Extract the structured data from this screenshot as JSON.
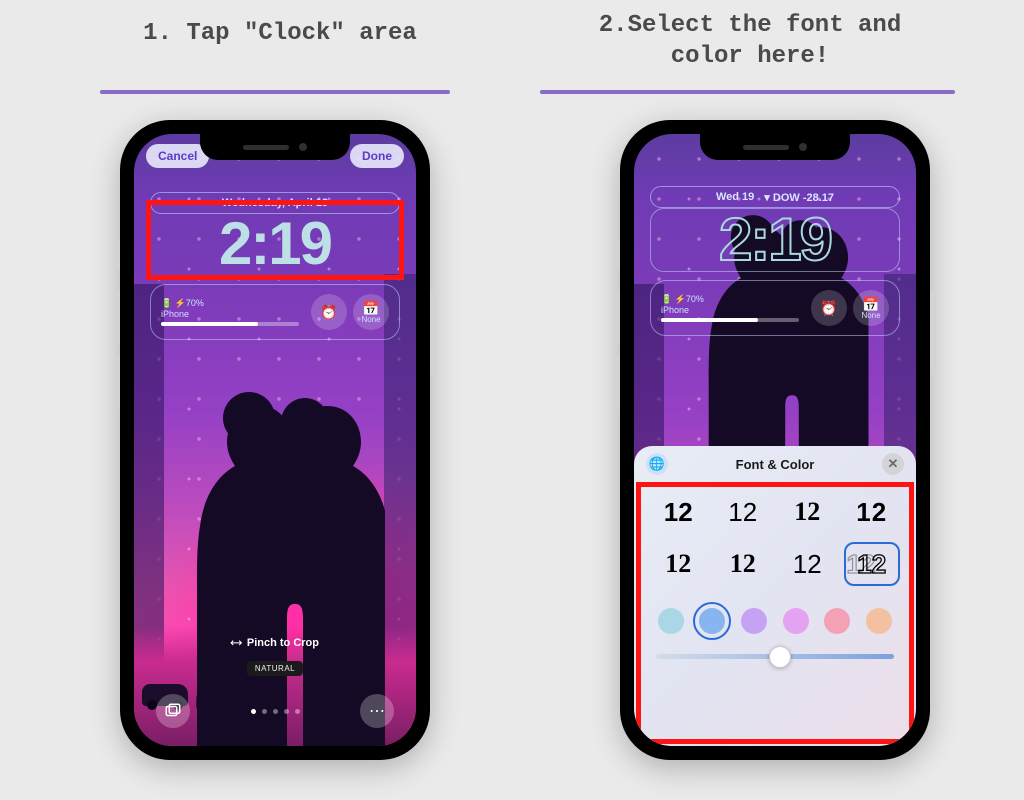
{
  "steps": {
    "one": "1. Tap \"Clock\" area",
    "two": "2.Select the font and\ncolor here!"
  },
  "phone1": {
    "top_actions": {
      "cancel": "Cancel",
      "done": "Done"
    },
    "date": "Wednesday, April 19",
    "clock": "2:19",
    "battery_widget": {
      "icon_label": "⚡70%",
      "device": "iPhone"
    },
    "widget_circles": {
      "alarm_icon": "⏰",
      "none_label": "None",
      "none_icon": "📅"
    },
    "pinch": "Pinch to Crop",
    "natural": "NATURAL"
  },
  "phone2": {
    "date_prefix": "Wed 19",
    "stock": "▾ DOW -28.17",
    "clock": "2:19",
    "battery_widget": {
      "icon_label": "⚡70%",
      "device": "iPhone"
    },
    "widget_circles": {
      "alarm_icon": "⏰",
      "none_label": "None",
      "none_icon": "📅"
    },
    "panel": {
      "title": "Font & Color",
      "font_sample": "12",
      "selected_font_index": 7,
      "colors": [
        "#a9d7e6",
        "#86b5f0",
        "#c6a2f2",
        "#e3a2f2",
        "#f2a2b4",
        "#f2c1a2"
      ],
      "selected_color_index": 1,
      "slider_pct": 52
    }
  }
}
